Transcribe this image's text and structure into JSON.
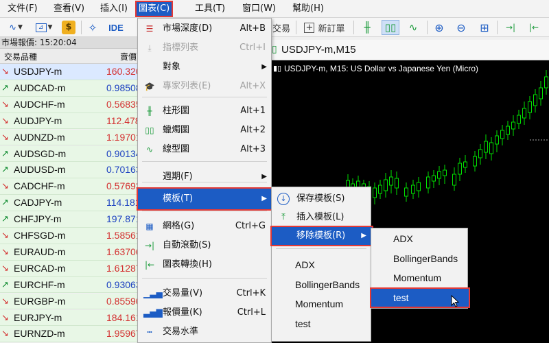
{
  "menubar": [
    "文件(F)",
    "查看(V)",
    "插入(I)",
    "圖表(C)",
    "工具(T)",
    "窗口(W)",
    "幫助(H)"
  ],
  "toolbar": {
    "ide_label": "IDE",
    "trade_label": "交易",
    "new_order_label": "新訂單"
  },
  "market_watch": {
    "status": "市場報價: 15:20:04",
    "col_symbol": "交易品種",
    "col_bid": "賣價",
    "rows": [
      {
        "symbol": "USDJPY-m",
        "bid": "160.320",
        "dir": "down"
      },
      {
        "symbol": "AUDCAD-m",
        "bid": "0.98508",
        "dir": "up"
      },
      {
        "symbol": "AUDCHF-m",
        "bid": "0.56835",
        "dir": "down"
      },
      {
        "symbol": "AUDJPY-m",
        "bid": "112.478",
        "dir": "down"
      },
      {
        "symbol": "AUDNZD-m",
        "bid": "1.19701",
        "dir": "down"
      },
      {
        "symbol": "AUDSGD-m",
        "bid": "0.90134",
        "dir": "up"
      },
      {
        "symbol": "AUDUSD-m",
        "bid": "0.70163",
        "dir": "up"
      },
      {
        "symbol": "CADCHF-m",
        "bid": "0.57693",
        "dir": "down"
      },
      {
        "symbol": "CADJPY-m",
        "bid": "114.181",
        "dir": "up"
      },
      {
        "symbol": "CHFJPY-m",
        "bid": "197.871",
        "dir": "up"
      },
      {
        "symbol": "CHFSGD-m",
        "bid": "1.58561",
        "dir": "down"
      },
      {
        "symbol": "EURAUD-m",
        "bid": "1.63706",
        "dir": "down"
      },
      {
        "symbol": "EURCAD-m",
        "bid": "1.61287",
        "dir": "down"
      },
      {
        "symbol": "EURCHF-m",
        "bid": "0.93063",
        "dir": "up"
      },
      {
        "symbol": "EURGBP-m",
        "bid": "0.85590",
        "dir": "down"
      },
      {
        "symbol": "EURJPY-m",
        "bid": "184.161",
        "dir": "down"
      },
      {
        "symbol": "EURNZD-m",
        "bid": "1.95967",
        "dir": "down"
      }
    ]
  },
  "chart": {
    "tab_title": "USDJPY-m,M15",
    "title": "USDJPY-m, M15:  US Dollar vs Japanese Yen (Micro)"
  },
  "chart_menu": {
    "items": [
      {
        "label": "市場深度(D)",
        "shortcut": "Alt+B",
        "icon": "market-depth-icon",
        "disabled": false
      },
      {
        "label": "指標列表",
        "shortcut": "Ctrl+I",
        "icon": "indicators-list-icon",
        "disabled": true
      },
      {
        "label": "對象",
        "shortcut": "",
        "icon": "",
        "disabled": false,
        "submenu": true
      },
      {
        "label": "專家列表(E)",
        "shortcut": "Alt+X",
        "icon": "expert-list-icon",
        "disabled": true
      },
      {
        "label": "柱形圖",
        "shortcut": "Alt+1",
        "icon": "bar-chart-icon",
        "disabled": false
      },
      {
        "label": "蠟燭圖",
        "shortcut": "Alt+2",
        "icon": "candlestick-icon",
        "disabled": false
      },
      {
        "label": "線型圖",
        "shortcut": "Alt+3",
        "icon": "line-chart-icon",
        "disabled": false
      },
      {
        "label": "週期(F)",
        "shortcut": "",
        "icon": "",
        "disabled": false,
        "submenu": true
      },
      {
        "label": "模板(T)",
        "shortcut": "",
        "icon": "",
        "disabled": false,
        "submenu": true
      },
      {
        "label": "網格(G)",
        "shortcut": "Ctrl+G",
        "icon": "grid-icon",
        "disabled": false
      },
      {
        "label": "自動滾動(S)",
        "shortcut": "",
        "icon": "auto-scroll-icon",
        "disabled": false
      },
      {
        "label": "圖表轉換(H)",
        "shortcut": "",
        "icon": "chart-shift-icon",
        "disabled": false
      },
      {
        "label": "交易量(V)",
        "shortcut": "Ctrl+K",
        "icon": "volume-icon",
        "disabled": false
      },
      {
        "label": "報價量(K)",
        "shortcut": "Ctrl+L",
        "icon": "tick-volume-icon",
        "disabled": false
      },
      {
        "label": "交易水準",
        "shortcut": "",
        "icon": "trade-levels-icon",
        "disabled": false
      }
    ]
  },
  "template_menu": {
    "save": "保存模板(S)",
    "load": "插入模板(L)",
    "remove": "移除模板(R)",
    "templates": [
      "ADX",
      "BollingerBands",
      "Momentum",
      "test"
    ]
  },
  "remove_menu": {
    "templates": [
      "ADX",
      "BollingerBands",
      "Momentum",
      "test"
    ]
  },
  "colors": {
    "accent": "#1c5cc4",
    "highlight_box": "#e53935",
    "bull": "#00ff00"
  }
}
